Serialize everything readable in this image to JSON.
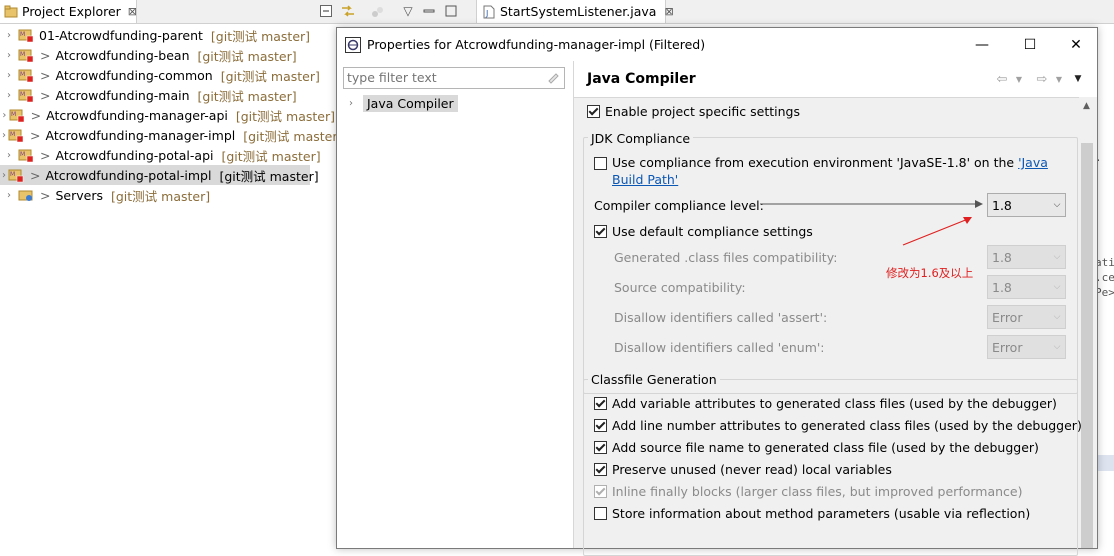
{
  "explorer": {
    "tab_title": "Project Explorer",
    "close_glyph": "⊠",
    "toolbar_icons": [
      "collapse-all-icon",
      "link-editor-icon",
      "filters-icon",
      "view-menu-icon",
      "minimize-icon",
      "maximize-icon"
    ],
    "tree": [
      {
        "dirty": "",
        "name": "01-Atcrowdfunding-parent",
        "git": "[git测试 master]"
      },
      {
        "dirty": ">",
        "name": "Atcrowdfunding-bean",
        "git": "[git测试 master]"
      },
      {
        "dirty": ">",
        "name": "Atcrowdfunding-common",
        "git": "[git测试 master]"
      },
      {
        "dirty": ">",
        "name": "Atcrowdfunding-main",
        "git": "[git测试 master]"
      },
      {
        "dirty": ">",
        "name": "Atcrowdfunding-manager-api",
        "git": "[git测试 master]"
      },
      {
        "dirty": ">",
        "name": "Atcrowdfunding-manager-impl",
        "git": "[git测试 master]"
      },
      {
        "dirty": ">",
        "name": "Atcrowdfunding-potal-api",
        "git": "[git测试 master]"
      },
      {
        "dirty": ">",
        "name": "Atcrowdfunding-potal-impl",
        "git": "[git测试 master]"
      },
      {
        "dirty": ">",
        "name": "Servers",
        "git": "[git测试 master]"
      }
    ]
  },
  "editor": {
    "tab_title": "StartSystemListener.java",
    "close_glyph": "⊠",
    "bg_fragments": [
      ".",
      "ati",
      ".ce",
      "Pe>"
    ]
  },
  "dialog": {
    "title": "Properties for Atcrowdfunding-manager-impl (Filtered)",
    "window_buttons": {
      "minimize": "—",
      "maximize": "☐",
      "close": "✕"
    },
    "filter_placeholder": "type filter text",
    "page_tree": [
      {
        "label": "Java Compiler"
      }
    ],
    "page_title": "Java Compiler",
    "enable_specific": {
      "label": "Enable project specific settings",
      "checked": true
    },
    "jdk_group": {
      "label": "JDK Compliance",
      "use_exec_env": {
        "label": "Use compliance from execution environment 'JavaSE-1.8' on the ",
        "link": "'Java Build Path'",
        "checked": false
      },
      "compliance_level": {
        "label": "Compiler compliance level:",
        "value": "1.8"
      },
      "use_default": {
        "label": "Use default compliance settings",
        "checked": true
      },
      "generated_compat": {
        "label": "Generated .class files compatibility:",
        "value": "1.8"
      },
      "source_compat": {
        "label": "Source compatibility:",
        "value": "1.8"
      },
      "assert_ids": {
        "label": "Disallow identifiers called 'assert':",
        "value": "Error"
      },
      "enum_ids": {
        "label": "Disallow identifiers called 'enum':",
        "value": "Error"
      }
    },
    "classfile_group": {
      "label": "Classfile Generation",
      "options": [
        {
          "label": "Add variable attributes to generated class files (used by the debugger)",
          "checked": true,
          "enabled": true
        },
        {
          "label": "Add line number attributes to generated class files (used by the debugger)",
          "checked": true,
          "enabled": true
        },
        {
          "label": "Add source file name to generated class file (used by the debugger)",
          "checked": true,
          "enabled": true
        },
        {
          "label": "Preserve unused (never read) local variables",
          "checked": true,
          "enabled": true
        },
        {
          "label": "Inline finally blocks (larger class files, but improved performance)",
          "checked": true,
          "enabled": false
        },
        {
          "label": "Store information about method parameters (usable via reflection)",
          "checked": false,
          "enabled": true
        }
      ]
    }
  },
  "annotation": {
    "text": "修改为1.6及以上",
    "color": "#e02020"
  }
}
